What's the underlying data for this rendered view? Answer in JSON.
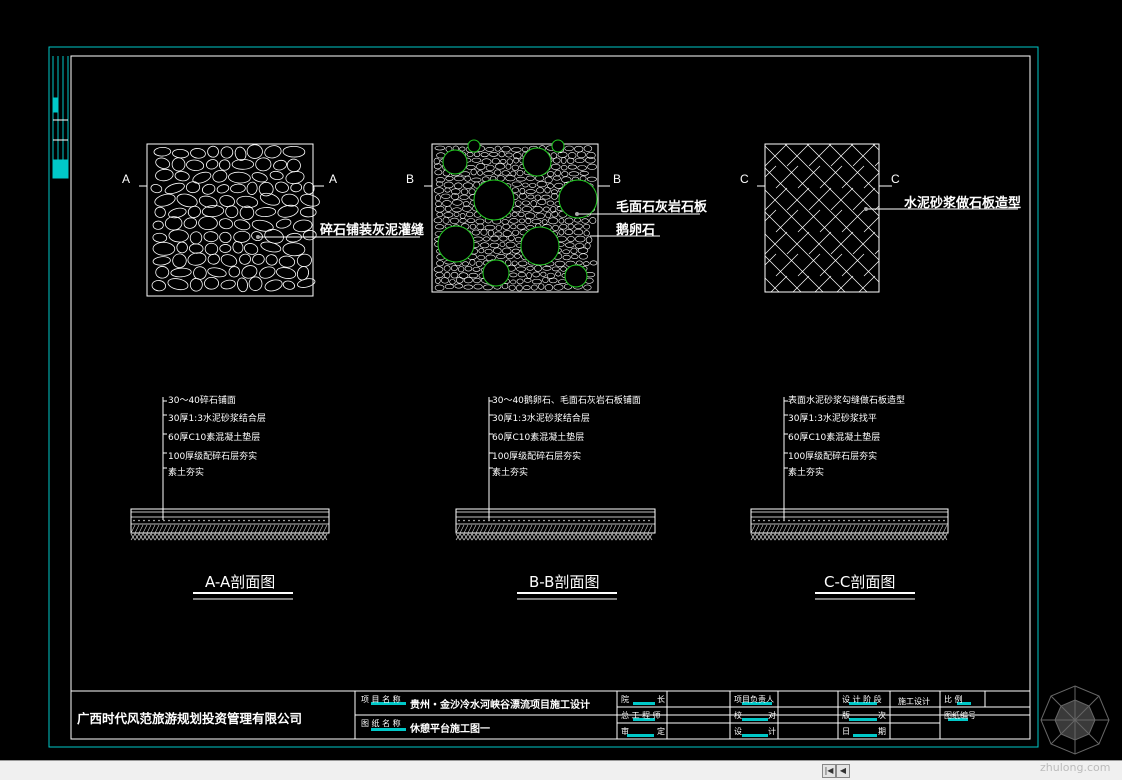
{
  "plans": [
    {
      "cut_left": "A",
      "cut_right": "A",
      "material": "碎石铺装灰泥灌缝"
    },
    {
      "cut_left": "B",
      "cut_right": "B",
      "material_1": "毛面石灰岩石板",
      "material_2": "鹅卵石"
    },
    {
      "cut_left": "C",
      "cut_right": "C",
      "material": "水泥砂浆做石板造型"
    }
  ],
  "sections": [
    {
      "title": "A-A剖面图",
      "layers": [
        "30～40碎石铺面",
        "30厚1:3水泥砂浆结合层",
        "60厚C10素混凝土垫层",
        "100厚级配碎石层夯实",
        "素土夯实"
      ]
    },
    {
      "title": "B-B剖面图",
      "layers": [
        "30～40鹅卵石、毛面石灰岩石板铺面",
        "30厚1:3水泥砂浆结合层",
        "60厚C10素混凝土垫层",
        "100厚级配碎石层夯实",
        "素土夯实"
      ]
    },
    {
      "title": "C-C剖面图",
      "layers": [
        "表面水泥砂浆勾缝做石板造型",
        "30厚1:3水泥砂浆找平",
        "60厚C10素混凝土垫层",
        "100厚级配碎石层夯实",
        "素土夯实"
      ]
    }
  ],
  "title_block": {
    "company": "广西时代风范旅游规划投资管理有限公司",
    "project_name_label": "项 目 名 称",
    "project_name": "贵州・金沙冷水河峡谷漂流项目施工设计",
    "drawing_name_label": "图 纸 名 称",
    "drawing_name": "休憩平台施工图一",
    "院长": "院",
    "长": "长",
    "总工程师": "总 工 程 师",
    "审定_1": "审",
    "审定_2": "定",
    "项目负责人": "项目负责人",
    "校对_1": "校",
    "校对_2": "对",
    "设计_1": "设",
    "设计_2": "计",
    "设计阶段": "设 计 阶 段",
    "施工设计": "施工设计",
    "比例": "比    例",
    "版次_1": "版",
    "版次_2": "次",
    "图纸编号": "图纸编号",
    "日期_1": "日",
    "日期_2": "期"
  },
  "watermark": "zhulong.com",
  "colors": {
    "frame": "#00c8c8",
    "circle": "#22cc22",
    "line": "#ffffff",
    "hatch": "#d0d0d0"
  }
}
